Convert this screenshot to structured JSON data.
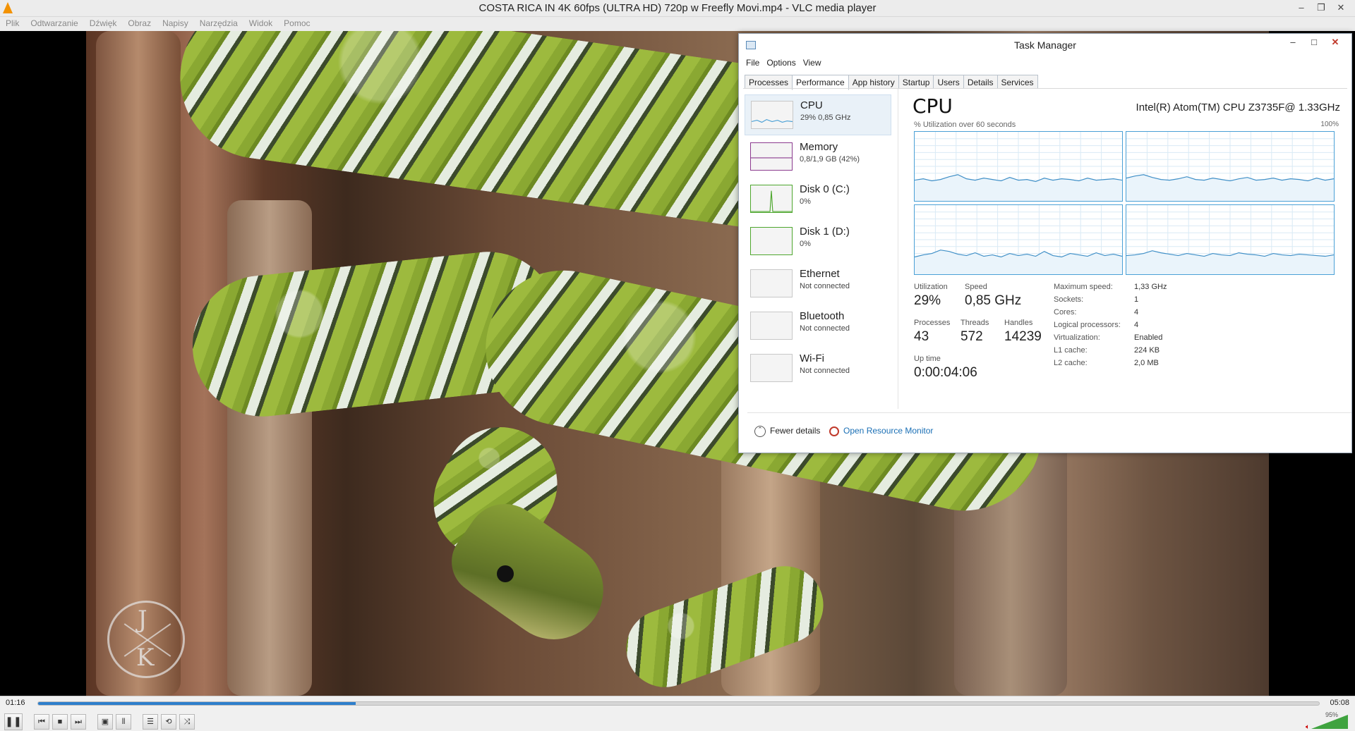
{
  "vlc": {
    "title": "COSTA RICA IN 4K 60fps (ULTRA HD) 720p w  Freefly Movi.mp4 - VLC media player",
    "menu": [
      "Plik",
      "Odtwarzanie",
      "Dźwięk",
      "Obraz",
      "Napisy",
      "Narzędzia",
      "Widok",
      "Pomoc"
    ],
    "elapsed": "01:16",
    "total": "05:08",
    "progress_fraction": 0.248,
    "volume": "95%",
    "accent_color": "#2e7fcc",
    "watermark_letters": [
      "J",
      "K"
    ]
  },
  "taskmanager": {
    "title": "Task Manager",
    "menu": [
      "File",
      "Options",
      "View"
    ],
    "tabs": [
      "Processes",
      "Performance",
      "App history",
      "Startup",
      "Users",
      "Details",
      "Services"
    ],
    "active_tab": "Performance",
    "resources": [
      {
        "name": "CPU",
        "sub": "29%  0,85 GHz",
        "color": "#4aa0d6",
        "icon": "cpu-graph"
      },
      {
        "name": "Memory",
        "sub": "0,8/1,9 GB (42%)",
        "color": "#8b3b8f",
        "icon": "memory-graph"
      },
      {
        "name": "Disk 0 (C:)",
        "sub": "0%",
        "color": "#4ea72e",
        "icon": "disk-graph"
      },
      {
        "name": "Disk 1 (D:)",
        "sub": "0%",
        "color": "#4ea72e",
        "icon": "disk-graph"
      },
      {
        "name": "Ethernet",
        "sub": "Not connected",
        "color": "#b0b0b0",
        "icon": "network-graph"
      },
      {
        "name": "Bluetooth",
        "sub": "Not connected",
        "color": "#b0b0b0",
        "icon": "network-graph"
      },
      {
        "name": "Wi-Fi",
        "sub": "Not connected",
        "color": "#b0b0b0",
        "icon": "network-graph"
      }
    ],
    "detail": {
      "heading": "CPU",
      "model": "Intel(R) Atom(TM) CPU Z3735F@ 1.33GHz",
      "util_label": "% Utilization over 60 seconds",
      "util_max": "100%",
      "stats": {
        "utilization_label": "Utilization",
        "utilization": "29%",
        "speed_label": "Speed",
        "speed": "0,85 GHz",
        "processes_label": "Processes",
        "processes": "43",
        "threads_label": "Threads",
        "threads": "572",
        "handles_label": "Handles",
        "handles": "14239",
        "uptime_label": "Up time",
        "uptime": "0:00:04:06"
      },
      "specs": [
        {
          "k": "Maximum speed:",
          "v": "1,33 GHz"
        },
        {
          "k": "Sockets:",
          "v": "1"
        },
        {
          "k": "Cores:",
          "v": "4"
        },
        {
          "k": "Logical processors:",
          "v": "4"
        },
        {
          "k": "Virtualization:",
          "v": "Enabled"
        },
        {
          "k": "L1 cache:",
          "v": "224 KB"
        },
        {
          "k": "L2 cache:",
          "v": "2,0 MB"
        }
      ],
      "core_history": [
        [
          30,
          32,
          29,
          31,
          35,
          38,
          32,
          30,
          33,
          31,
          29,
          34,
          30,
          31,
          28,
          33,
          30,
          32,
          31,
          29,
          33,
          30,
          31,
          32,
          30
        ],
        [
          33,
          36,
          38,
          34,
          31,
          30,
          32,
          35,
          31,
          30,
          33,
          31,
          29,
          32,
          34,
          30,
          31,
          33,
          30,
          32,
          31,
          29,
          33,
          30,
          32
        ],
        [
          25,
          28,
          30,
          35,
          33,
          29,
          27,
          31,
          26,
          28,
          25,
          30,
          27,
          29,
          26,
          33,
          27,
          25,
          30,
          28,
          26,
          31,
          27,
          29,
          26
        ],
        [
          27,
          28,
          30,
          34,
          31,
          29,
          27,
          30,
          28,
          26,
          30,
          28,
          27,
          31,
          29,
          28,
          26,
          30,
          28,
          27,
          29,
          28,
          27,
          26,
          28
        ]
      ]
    },
    "footer": {
      "fewer": "Fewer details",
      "resource_monitor": "Open Resource Monitor"
    }
  }
}
